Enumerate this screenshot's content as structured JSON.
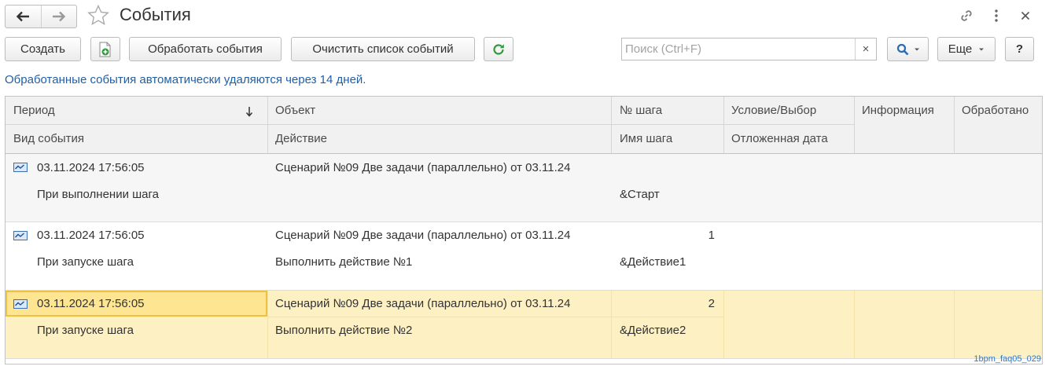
{
  "window": {
    "title": "События",
    "watermark": "1bpm_faq05_029"
  },
  "toolbar": {
    "create_label": "Создать",
    "process_label": "Обработать события",
    "clear_label": "Очистить список событий",
    "search_placeholder": "Поиск (Ctrl+F)",
    "search_clear": "×",
    "more_label": "Еще",
    "help_label": "?"
  },
  "info_text": "Обработанные события автоматически удаляются через 14 дней.",
  "table": {
    "headers": {
      "period": "Период",
      "object": "Объект",
      "step_no": "№ шага",
      "condition": "Условие/Выбор",
      "information": "Информация",
      "processed": "Обработано",
      "event_type": "Вид события",
      "action": "Действие",
      "step_name": "Имя шага",
      "deferred_date": "Отложенная дата"
    },
    "rows": [
      {
        "period": "03.11.2024 17:56:05",
        "object": "Сценарий №09 Две задачи (параллельно) от 03.11.24",
        "step_no": "",
        "event_type": "При выполнении шага",
        "action": "",
        "step_name": "&Старт",
        "selected": false
      },
      {
        "period": "03.11.2024 17:56:05",
        "object": "Сценарий №09 Две задачи (параллельно) от 03.11.24",
        "step_no": "1",
        "event_type": "При запуске шага",
        "action": "Выполнить действие №1",
        "step_name": "&Действие1",
        "selected": false
      },
      {
        "period": "03.11.2024 17:56:05",
        "object": "Сценарий №09 Две задачи (параллельно) от 03.11.24",
        "step_no": "2",
        "event_type": "При запуске шага",
        "action": "Выполнить действие №2",
        "step_name": "&Действие2",
        "selected": true
      }
    ]
  },
  "colors": {
    "info_text": "#1f5fa6",
    "selection": "#fdf0c2",
    "selection_border": "#f0c040",
    "header_bg": "#f1f1f1",
    "watermark": "#2b78c8"
  },
  "icons": {
    "back": "arrow-left-icon",
    "forward": "arrow-right-icon",
    "favorite": "star-icon",
    "link": "link-icon",
    "menu": "kebab-menu-icon",
    "close": "close-icon",
    "add_copy": "document-add-icon",
    "refresh": "refresh-icon",
    "search": "search-icon",
    "sort": "sort-down-arrow-icon",
    "event": "event-chart-icon"
  }
}
